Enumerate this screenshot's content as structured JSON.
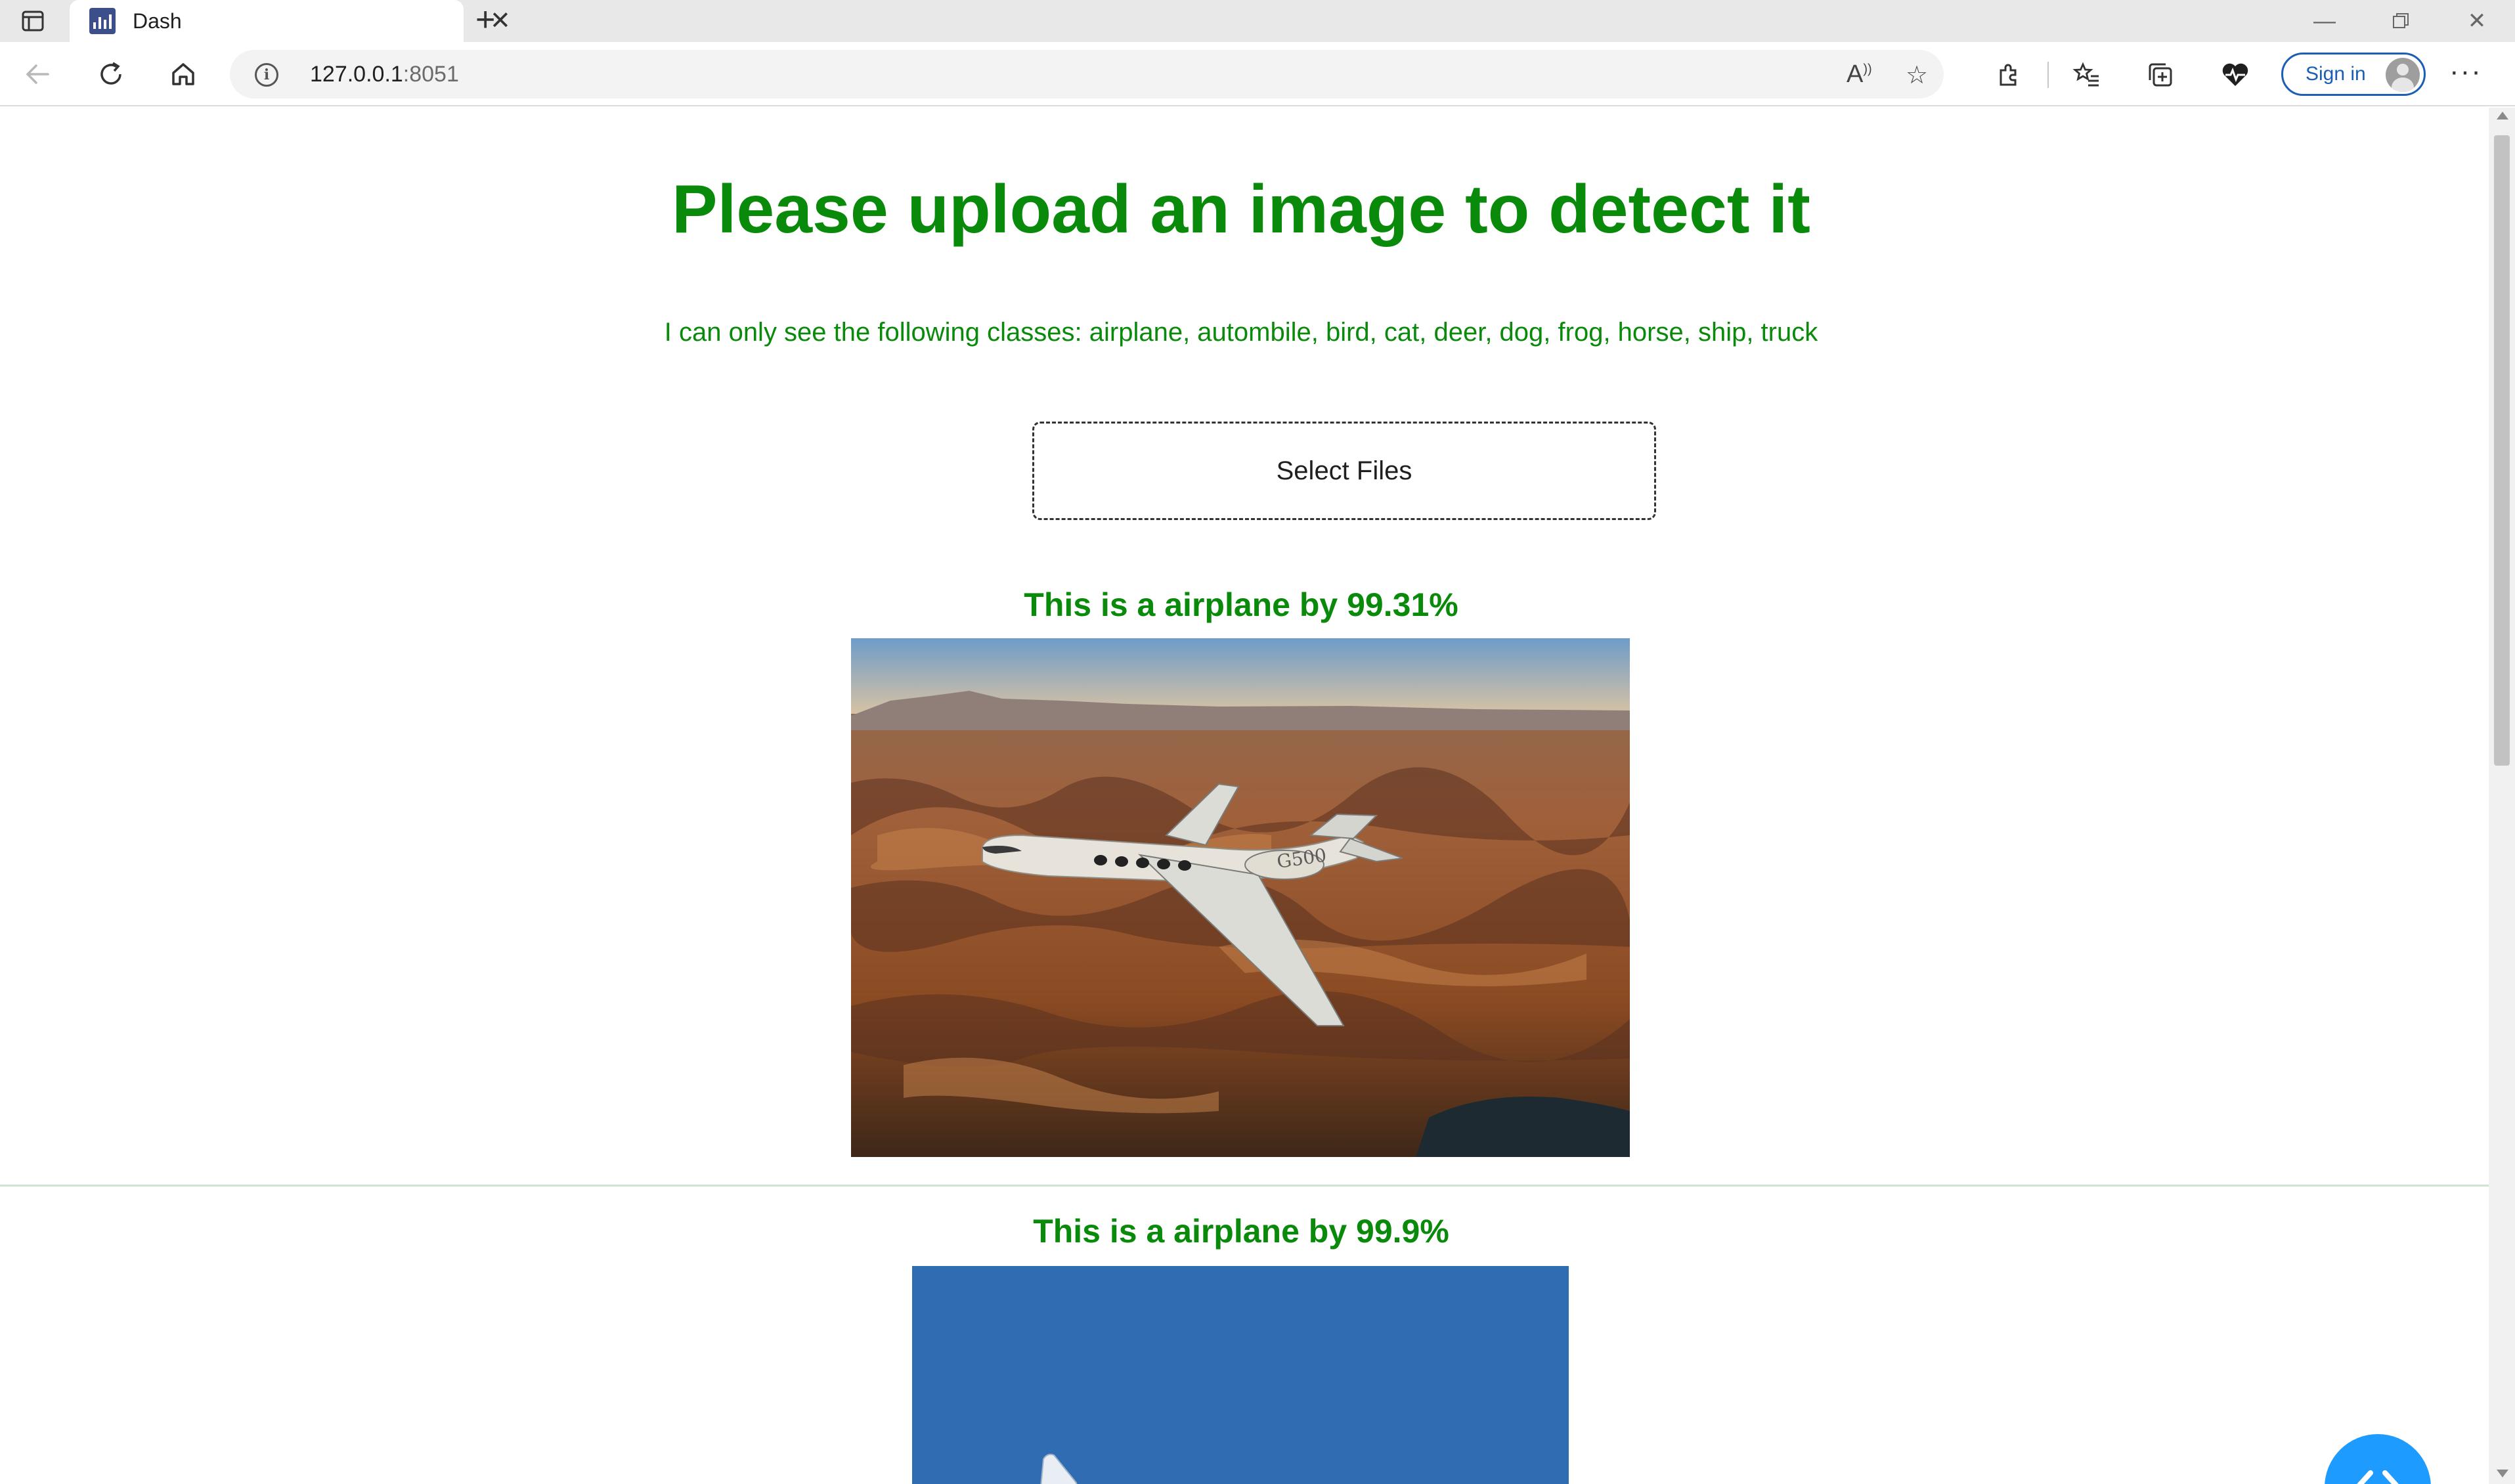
{
  "browser": {
    "tab_title": "Dash",
    "address_host": "127.0.0.1",
    "address_port": ":8051",
    "sign_in_label": "Sign in"
  },
  "page": {
    "title": "Please upload an image to detect it",
    "subtitle": "I can only see the following classes: airplane, autombile, bird, cat, deer, dog, frog, horse, ship, truck",
    "upload_label": "Select Files",
    "results": [
      {
        "label": "This is a airplane by 99.31%"
      },
      {
        "label": "This is a airplane by 99.9%"
      }
    ],
    "photo_text": "G500"
  },
  "colors": {
    "accent_green": "#0a8a0a",
    "fab_blue": "#1e9bff",
    "link_blue": "#1a5fb4"
  },
  "icons": {
    "tab_actions": "tab-actions-icon",
    "back": "back-arrow-icon",
    "refresh": "refresh-icon",
    "home": "home-icon",
    "info": "info-icon",
    "read_aloud": "read-aloud-icon",
    "add_favorite": "add-favorite-icon",
    "extensions": "extensions-icon",
    "favorites": "favorites-icon",
    "collections": "collections-icon",
    "health": "browser-essentials-icon",
    "more": "more-icon",
    "code": "code-icon"
  }
}
